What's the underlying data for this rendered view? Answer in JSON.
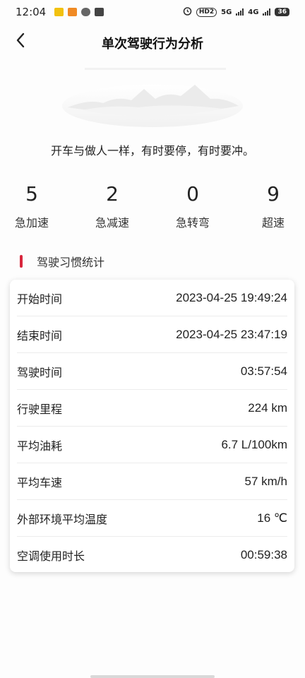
{
  "status_bar": {
    "time": "12:04",
    "network_badge": "HD2",
    "net1": "5G",
    "net2": "4G",
    "battery": "36"
  },
  "header": {
    "title": "单次驾驶行为分析"
  },
  "quote": "开车与做人一样，有时要停，有时要冲。",
  "stats": [
    {
      "value": "5",
      "label": "急加速"
    },
    {
      "value": "2",
      "label": "急减速"
    },
    {
      "value": "0",
      "label": "急转弯"
    },
    {
      "value": "9",
      "label": "超速"
    }
  ],
  "section": {
    "title": "驾驶习惯统计",
    "accent_color": "#d8263c"
  },
  "details": [
    {
      "label": "开始时间",
      "value": "2023-04-25 19:49:24"
    },
    {
      "label": "结束时间",
      "value": "2023-04-25 23:47:19"
    },
    {
      "label": "驾驶时间",
      "value": "03:57:54"
    },
    {
      "label": "行驶里程",
      "value": "224 km"
    },
    {
      "label": "平均油耗",
      "value": "6.7 L/100km"
    },
    {
      "label": "平均车速",
      "value": "57 km/h"
    },
    {
      "label": "外部环境平均温度",
      "value": "16 ℃"
    },
    {
      "label": "空调使用时长",
      "value": "00:59:38"
    }
  ]
}
